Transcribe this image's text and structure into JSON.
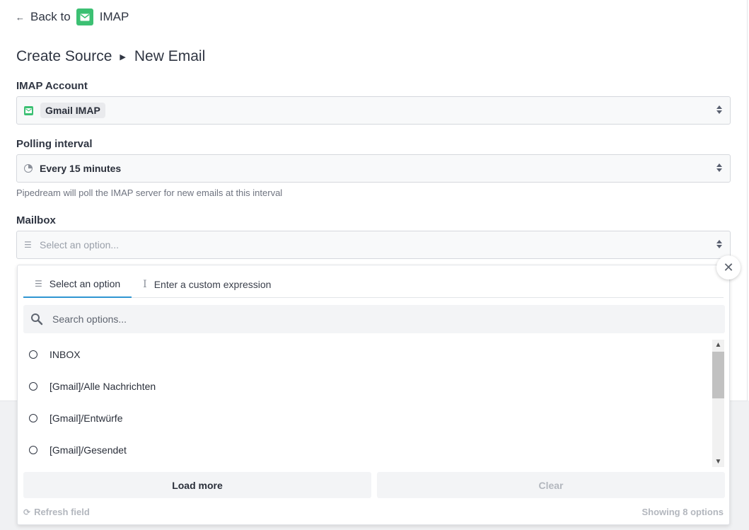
{
  "back_link": {
    "arrow": "←",
    "text": "Back",
    "to": "to",
    "app_name": "IMAP",
    "app_icon": "mail-icon",
    "accent_color": "#3cc073"
  },
  "breadcrumb": {
    "parent": "Create Source",
    "separator": "▶",
    "current": "New Email"
  },
  "imap_account": {
    "label": "IMAP Account",
    "value": "Gmail IMAP",
    "icon": "mail-icon"
  },
  "polling": {
    "label": "Polling interval",
    "value": "Every 15 minutes",
    "icon": "clock-icon",
    "help": "Pipedream will poll the IMAP server for new emails at this interval"
  },
  "mailbox": {
    "label": "Mailbox",
    "placeholder": "Select an option...",
    "tabs": [
      {
        "label": "Select an option",
        "icon": "list-icon",
        "active": true
      },
      {
        "label": "Enter a custom expression",
        "icon": "text-cursor-icon",
        "active": false
      }
    ],
    "search_placeholder": "Search options...",
    "options": [
      "INBOX",
      "[Gmail]/Alle Nachrichten",
      "[Gmail]/Entwürfe",
      "[Gmail]/Gesendet"
    ],
    "load_more_label": "Load more",
    "clear_label": "Clear",
    "refresh_label": "Refresh field",
    "count_label": "Showing 8 options",
    "close_symbol": "✕"
  },
  "colors": {
    "tab_active": "#2f95d1",
    "muted_text": "#b3b7be"
  }
}
